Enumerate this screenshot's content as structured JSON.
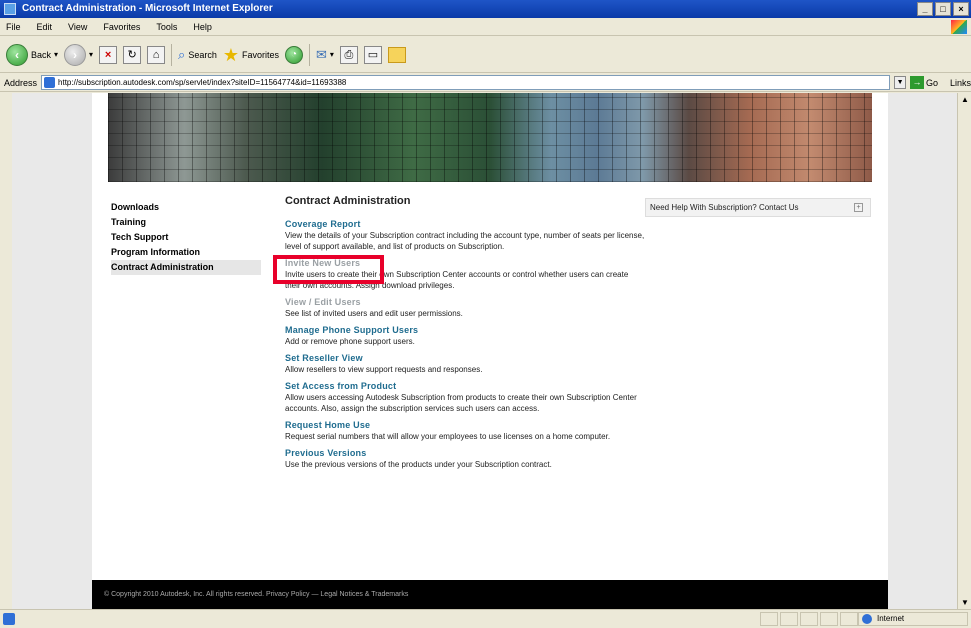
{
  "window": {
    "title": "Contract Administration - Microsoft Internet Explorer",
    "buttons": [
      "_",
      "□",
      "×"
    ]
  },
  "menu": [
    "File",
    "Edit",
    "View",
    "Favorites",
    "Tools",
    "Help"
  ],
  "toolbar": {
    "back_label": "Back",
    "search_label": "Search",
    "favorites_label": "Favorites"
  },
  "address": {
    "label": "Address",
    "url": "http://subscription.autodesk.com/sp/servlet/index?siteID=11564774&id=11693388",
    "go_label": "Go",
    "links_label": "Links"
  },
  "nav": {
    "items": [
      "Downloads",
      "Training",
      "Tech Support",
      "Program Information",
      "Contract Administration"
    ]
  },
  "main": {
    "heading": "Contract Administration",
    "items": [
      {
        "title": "Coverage Report",
        "desc": "View the details of your Subscription contract including the account type, number of seats per license, level of support available, and list of products on Subscription."
      },
      {
        "title": "Invite New Users",
        "desc": "Invite users to create their own Subscription Center accounts or control whether users can create their own accounts. Assign download privileges."
      },
      {
        "title": "View / Edit Users",
        "desc": "See list of invited users and edit user permissions."
      },
      {
        "title": "Manage Phone Support Users",
        "desc": "Add or remove phone support users."
      },
      {
        "title": "Set Reseller View",
        "desc": "Allow resellers to view support requests and responses."
      },
      {
        "title": "Set Access from Product",
        "desc": "Allow users accessing Autodesk Subscription from products to create their own Subscription Center accounts. Also, assign the subscription services such users can access."
      },
      {
        "title": "Request Home Use",
        "desc": "Request serial numbers that will allow your employees to use licenses on a home computer."
      },
      {
        "title": "Previous Versions",
        "desc": "Use the previous versions of the products under your Subscription contract."
      }
    ]
  },
  "help": {
    "label": "Need Help With Subscription? Contact Us",
    "toggle": "+"
  },
  "footer": {
    "text": "© Copyright 2010 Autodesk, Inc. All rights reserved.   Privacy Policy — Legal Notices & Trademarks"
  },
  "status": {
    "zone": "Internet"
  },
  "colors": {
    "link": "#1f6c8f",
    "highlight": "#e8002a",
    "titlebar": "#0a3aa8"
  }
}
